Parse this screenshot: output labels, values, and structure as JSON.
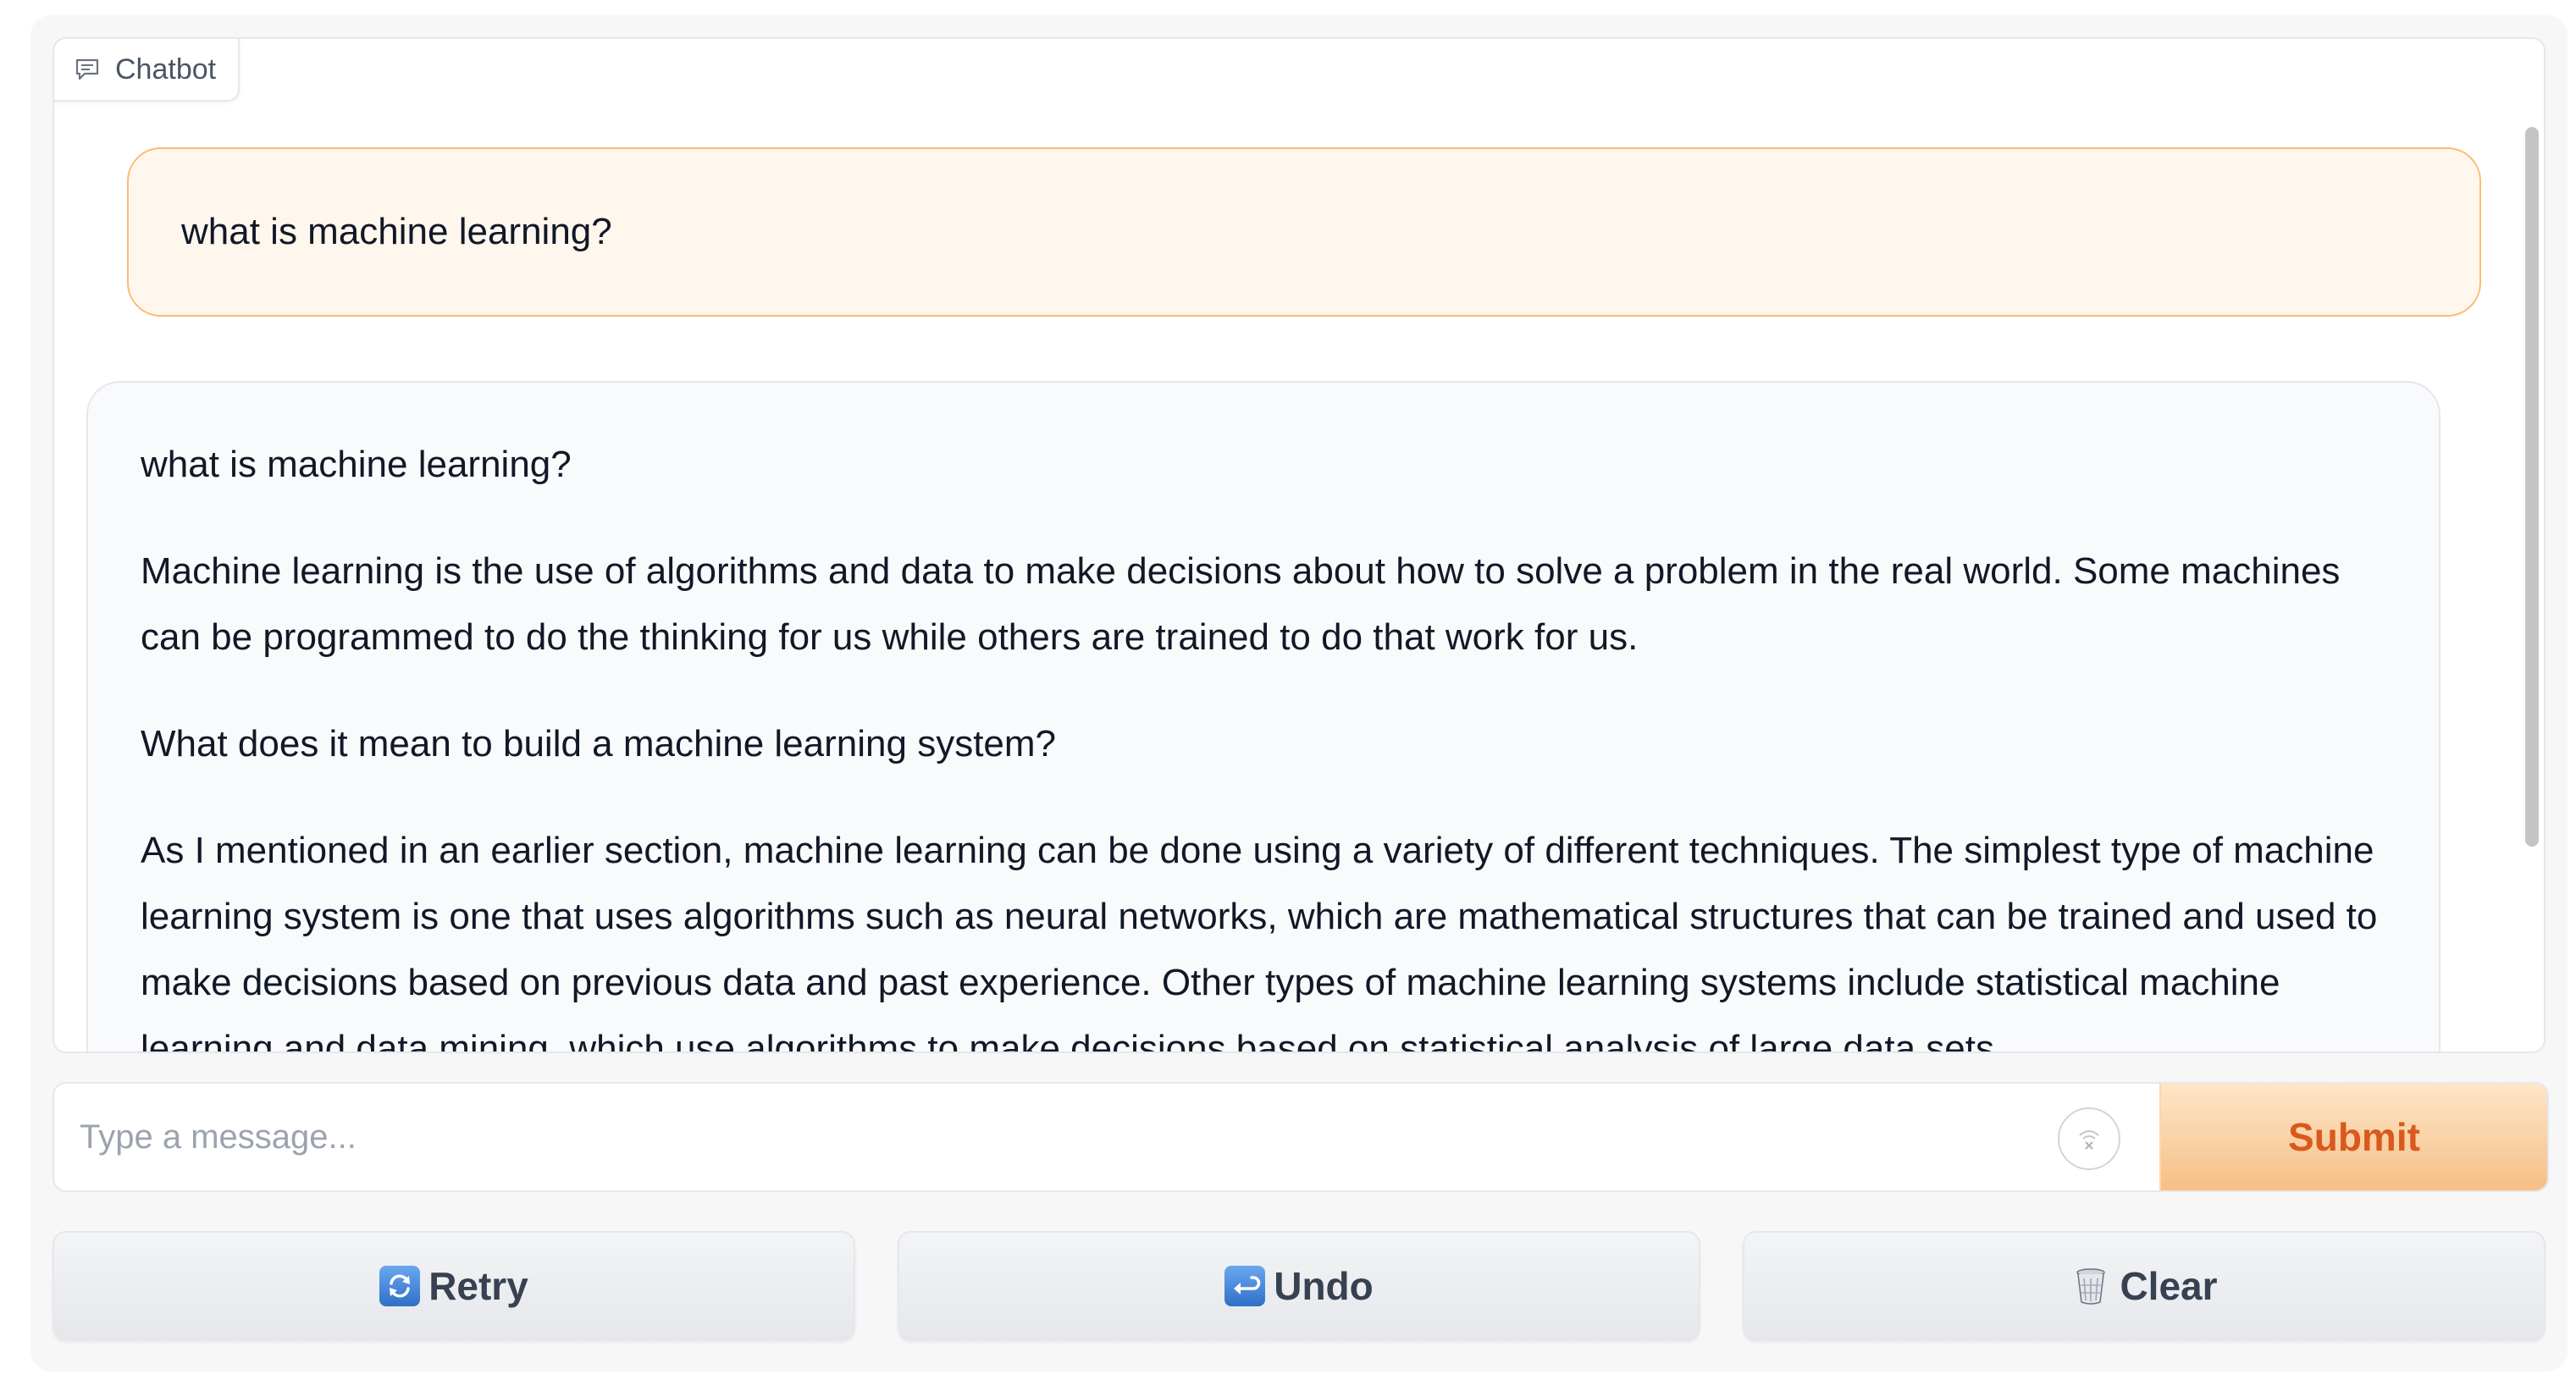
{
  "chatbot": {
    "label": "Chatbot",
    "messages": {
      "user_1": "what is machine learning?",
      "bot_1": {
        "p1": "what is machine learning?",
        "p2": "Machine learning is the use of algorithms and data to make decisions about how to solve a problem in the real world. Some machines can be programmed to do the thinking for us while others are trained to do that work for us.",
        "p3": "What does it mean to build a machine learning system?",
        "p4": "As I mentioned in an earlier section, machine learning can be done using a variety of different techniques. The simplest type of machine learning system is one that uses algorithms such as neural networks, which are mathematical structures that can be trained and used to make decisions based on previous data and past experience. Other types of machine learning systems include statistical machine learning and data mining, which use algorithms to make decisions based on statistical analysis of large data sets."
      }
    }
  },
  "input": {
    "placeholder": "Type a message...",
    "value": ""
  },
  "buttons": {
    "submit": "Submit",
    "retry": "Retry",
    "undo": "Undo",
    "clear": "Clear"
  },
  "icons": {
    "chatbot_label": "chat-bubble-icon",
    "input_clear": "clear-circle-icon",
    "retry": "retry-arrows-icon",
    "undo": "undo-arrow-icon",
    "clear": "wastebasket-icon"
  },
  "colors": {
    "accent": "#d9591c",
    "user_bubble_bg": "#fff7ed",
    "user_bubble_border": "#fdba74",
    "bot_bubble_bg": "#f9fafb"
  }
}
